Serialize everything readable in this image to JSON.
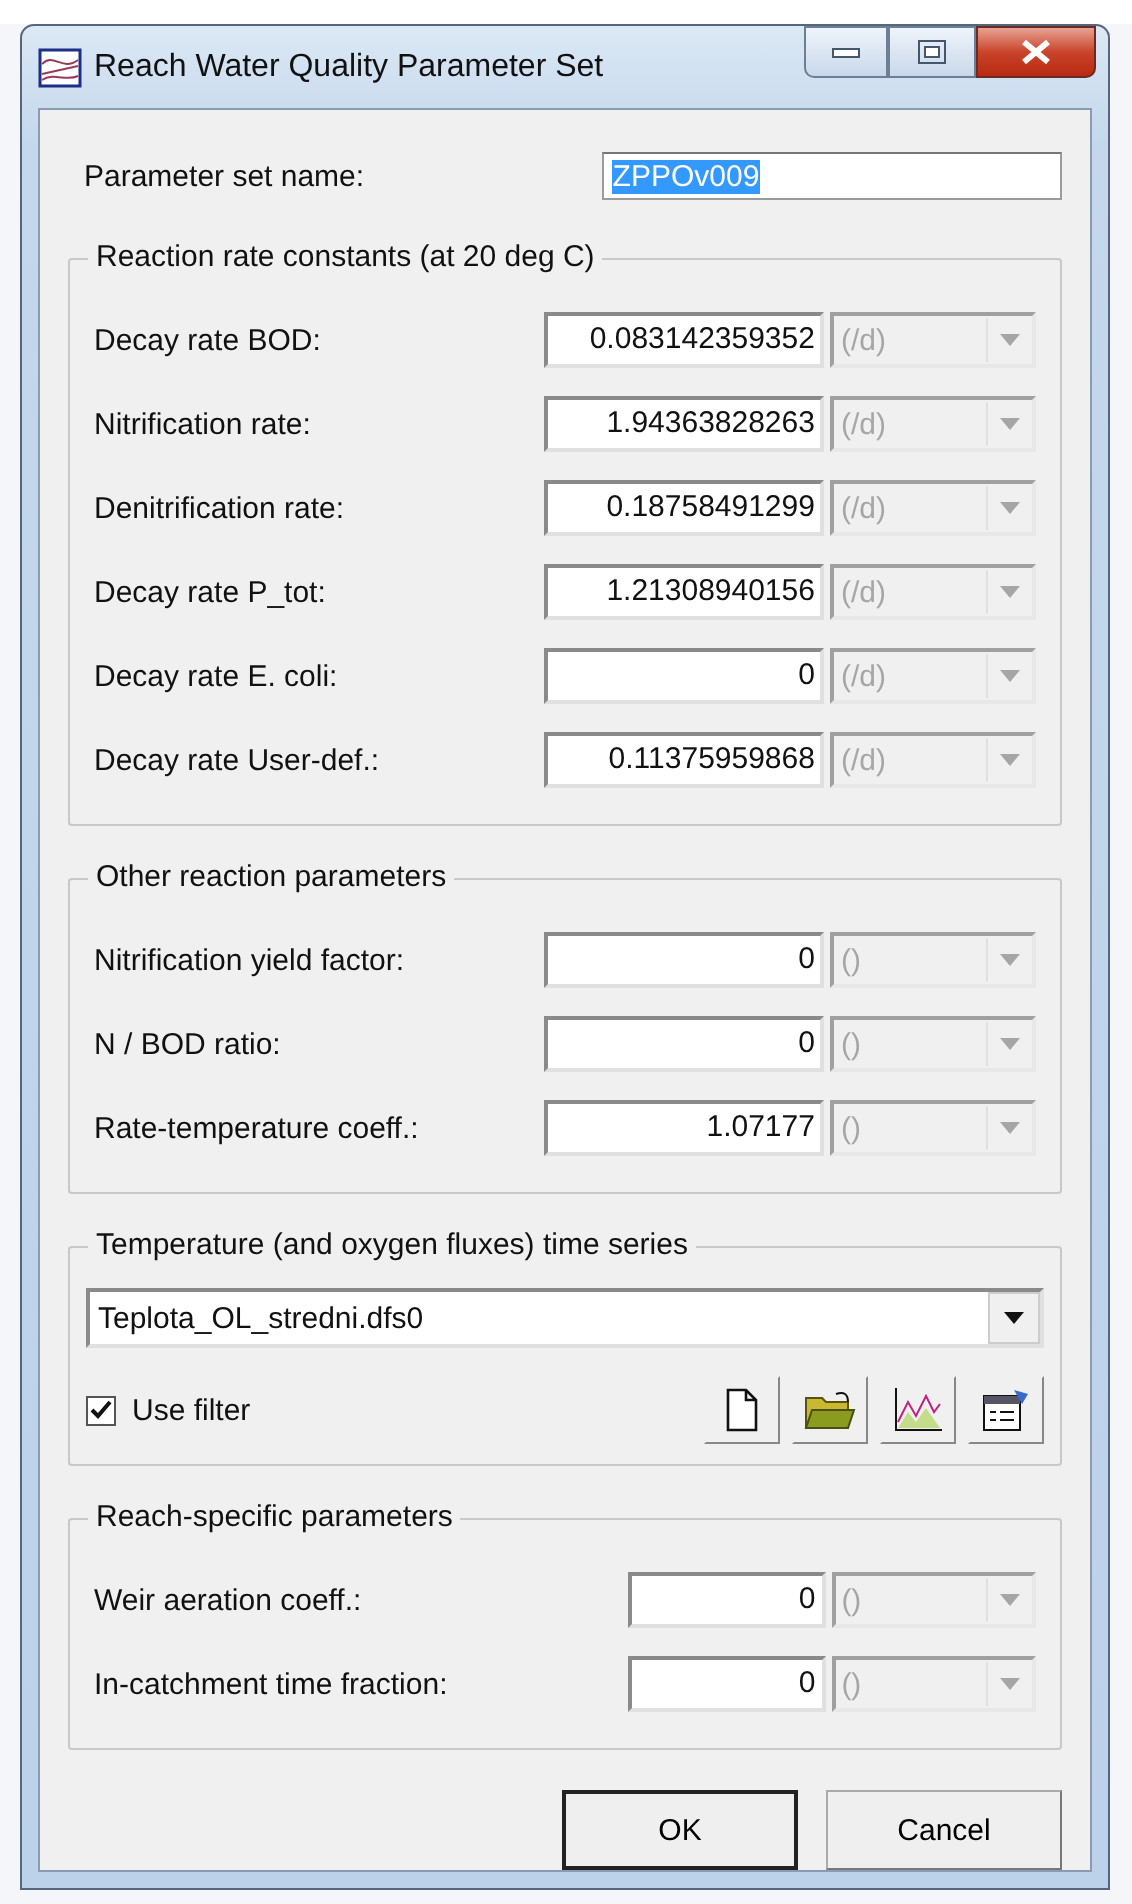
{
  "window": {
    "title": "Reach Water Quality Parameter Set"
  },
  "name_field": {
    "label": "Parameter set name:",
    "value": "ZPPOv009",
    "text_selected": true
  },
  "groups": [
    {
      "title": "Reaction rate constants (at 20 deg C)",
      "rows": [
        {
          "label": "Decay rate BOD:",
          "value": "0.083142359352",
          "unit": "(/d)",
          "unit_disabled": true
        },
        {
          "label": "Nitrification rate:",
          "value": "1.94363828263",
          "unit": "(/d)",
          "unit_disabled": true
        },
        {
          "label": "Denitrification rate:",
          "value": "0.18758491299",
          "unit": "(/d)",
          "unit_disabled": true
        },
        {
          "label": "Decay rate P_tot:",
          "value": "1.21308940156",
          "unit": "(/d)",
          "unit_disabled": true
        },
        {
          "label": "Decay rate E. coli:",
          "value": "0",
          "unit": "(/d)",
          "unit_disabled": true
        },
        {
          "label": "Decay rate User-def.:",
          "value": "0.11375959868",
          "unit": "(/d)",
          "unit_disabled": true
        }
      ]
    },
    {
      "title": "Other reaction parameters",
      "rows": [
        {
          "label": "Nitrification yield factor:",
          "value": "0",
          "unit": "()",
          "unit_disabled": true
        },
        {
          "label": "N / BOD ratio:",
          "value": "0",
          "unit": "()",
          "unit_disabled": true
        },
        {
          "label": "Rate-temperature coeff.:",
          "value": "1.07177",
          "unit": "()",
          "unit_disabled": true
        }
      ]
    }
  ],
  "time_series": {
    "title": "Temperature (and oxygen fluxes) time series",
    "file": "Teplota_OL_stredni.dfs0",
    "filter": {
      "label": "Use filter",
      "checked": true
    }
  },
  "reach_group": {
    "title": "Reach-specific parameters",
    "rows": [
      {
        "label": "Weir aeration coeff.:",
        "value": "0",
        "unit": "()",
        "unit_disabled": true
      },
      {
        "label": "In-catchment time fraction:",
        "value": "0",
        "unit": "()",
        "unit_disabled": true
      }
    ]
  },
  "buttons": [
    {
      "label": "OK",
      "default": true
    },
    {
      "label": "Cancel",
      "default": false
    }
  ]
}
